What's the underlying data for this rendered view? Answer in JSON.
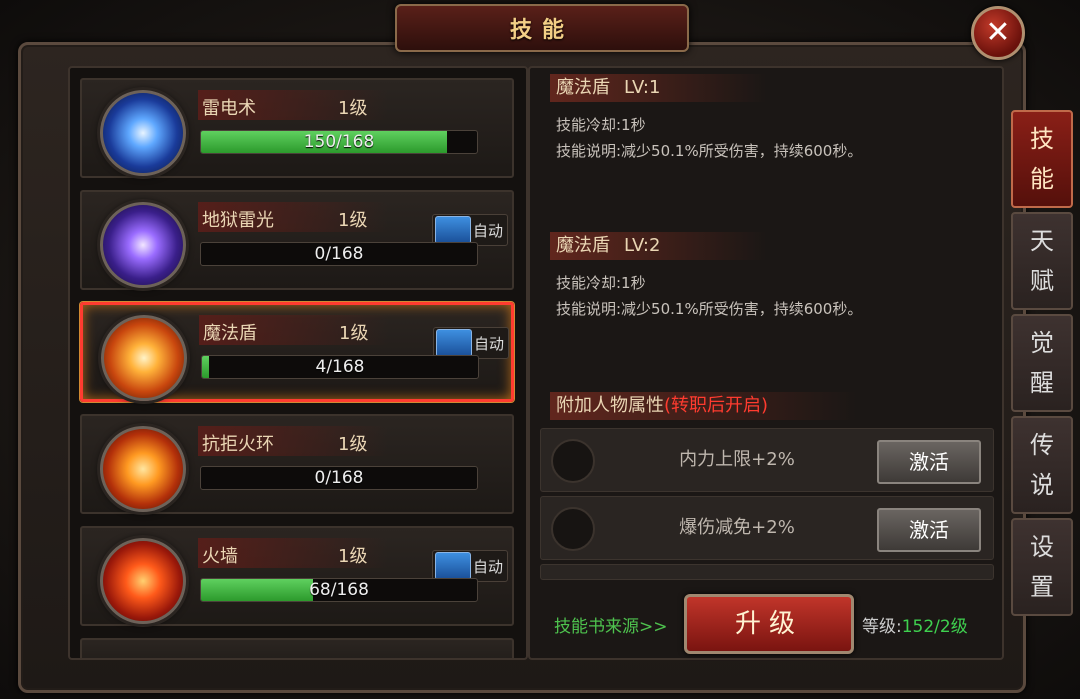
{
  "window": {
    "title": "技能",
    "close_symbol": "✕"
  },
  "skills": [
    {
      "name": "雷电术",
      "level": "1级",
      "progress_text": "150/168",
      "progress": 0.893,
      "auto": false,
      "selected": false,
      "icon": "lightning-icon"
    },
    {
      "name": "地狱雷光",
      "level": "1级",
      "progress_text": "0/168",
      "progress": 0,
      "auto": true,
      "selected": false,
      "icon": "hell-lightning-icon"
    },
    {
      "name": "魔法盾",
      "level": "1级",
      "progress_text": "4/168",
      "progress": 0.024,
      "auto": true,
      "selected": true,
      "icon": "magic-shield-icon"
    },
    {
      "name": "抗拒火环",
      "level": "1级",
      "progress_text": "0/168",
      "progress": 0,
      "auto": false,
      "selected": false,
      "icon": "fire-ring-icon"
    },
    {
      "name": "火墙",
      "level": "1级",
      "progress_text": "68/168",
      "progress": 0.405,
      "auto": true,
      "selected": false,
      "icon": "fire-wall-icon"
    }
  ],
  "auto_label": "自动",
  "detail": {
    "current": {
      "name": "魔法盾",
      "lv": "LV:1",
      "cooldown": "技能冷却:1秒",
      "description": "技能说明:减少50.1%所受伤害，持续600秒。"
    },
    "next": {
      "name": "魔法盾",
      "lv": "LV:2",
      "cooldown": "技能冷却:1秒",
      "description": "技能说明:减少50.1%所受伤害，持续600秒。"
    }
  },
  "attributes": {
    "title": "附加人物属性",
    "title_note": "(转职后开启)",
    "items": [
      {
        "text": "内力上限+2%",
        "button": "激活"
      },
      {
        "text": "爆伤减免+2%",
        "button": "激活"
      }
    ]
  },
  "footer": {
    "source_link": "技能书来源>>",
    "upgrade_label": "升级",
    "grade_label": "等级:",
    "grade_value": "152/2级"
  },
  "tabs": [
    {
      "label": "技能",
      "active": true
    },
    {
      "label": "天赋",
      "active": false
    },
    {
      "label": "觉醒",
      "active": false
    },
    {
      "label": "传说",
      "active": false
    },
    {
      "label": "设置",
      "active": false
    }
  ],
  "colors": {
    "progress_green": "#3fb83f",
    "highlight_red": "#ff3b30",
    "note_red": "#ff3b2f",
    "link_green": "#4ec24e"
  }
}
